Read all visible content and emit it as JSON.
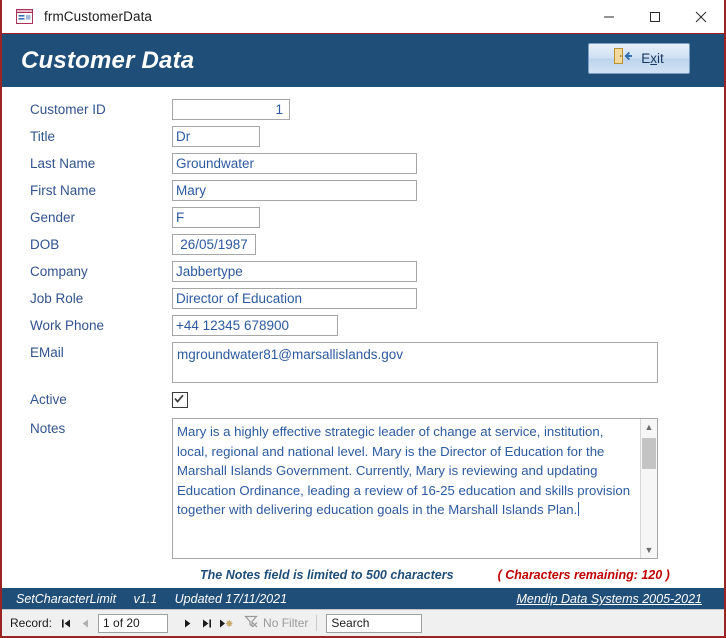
{
  "window": {
    "title": "frmCustomerData",
    "icon": "access-form-icon",
    "controls": {
      "minimize": "–",
      "maximize": "□",
      "close": "✕"
    }
  },
  "header": {
    "title": "Customer Data",
    "exit_button": {
      "label_pre": "E",
      "label_accel": "x",
      "label_post": "it",
      "icon": "exit-door-icon"
    },
    "background_color": "#1F4E79"
  },
  "form": {
    "fields": [
      {
        "label": "Customer ID",
        "value": "1",
        "type": "number"
      },
      {
        "label": "Title",
        "value": "Dr",
        "type": "text"
      },
      {
        "label": "Last Name",
        "value": "Groundwater",
        "type": "text"
      },
      {
        "label": "First Name",
        "value": "Mary",
        "type": "text"
      },
      {
        "label": "Gender",
        "value": "F",
        "type": "text"
      },
      {
        "label": "DOB",
        "value": "26/05/1987",
        "type": "date"
      },
      {
        "label": "Company",
        "value": "Jabbertype",
        "type": "text"
      },
      {
        "label": "Job Role",
        "value": "Director of Education",
        "type": "text"
      },
      {
        "label": "Work Phone",
        "value": "+44 12345 678900",
        "type": "text"
      },
      {
        "label": "EMail",
        "value": "mgroundwater81@marsallislands.gov",
        "type": "memo"
      }
    ],
    "active": {
      "label": "Active",
      "checked": true
    },
    "notes": {
      "label": "Notes",
      "value": "Mary is a highly effective strategic leader of change at service, institution, local, regional and national level. Mary is the Director of Education for the Marshall Islands Government. Currently, Mary is reviewing and updating Education Ordinance, leading a review of 16-25 education and skills provision together with delivering education goals in the Marshall Islands Plan."
    },
    "limit_note": "The Notes field is limited to 500 characters",
    "remaining_note": "( Characters remaining: 120 )",
    "limit_note_color": "#1F4E79",
    "remaining_note_color": "#C00000"
  },
  "statusbar": {
    "app_name": "SetCharacterLimit",
    "version": "v1.1",
    "updated": "Updated 17/11/2021",
    "link": "Mendip Data Systems 2005-2021"
  },
  "navigator": {
    "record_label": "Record:",
    "position": "1 of 20",
    "first_icon": "go-first-icon",
    "previous_icon": "go-previous-icon",
    "next_icon": "go-next-icon",
    "last_icon": "go-last-icon",
    "new_icon": "new-record-icon",
    "filter_label": "No Filter",
    "filter_icon": "filter-icon",
    "search_placeholder": "Search"
  }
}
